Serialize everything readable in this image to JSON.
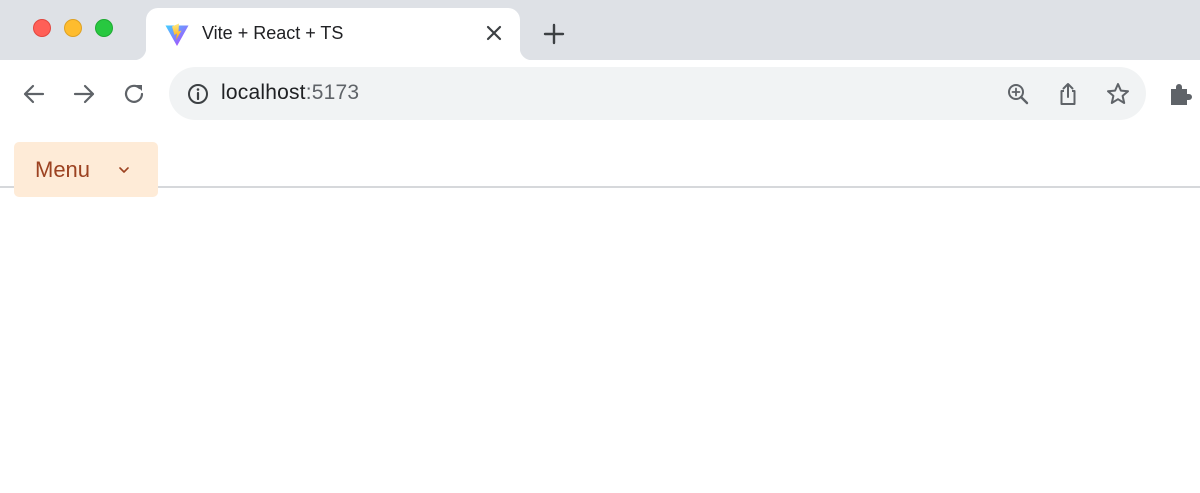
{
  "window": {
    "controls": [
      "close",
      "minimize",
      "zoom"
    ]
  },
  "tab": {
    "title": "Vite + React + TS",
    "favicon": "vite-logo-icon",
    "close_icon": "close-icon"
  },
  "new_tab_icon": "plus-icon",
  "toolbar": {
    "back_icon": "arrow-left-icon",
    "forward_icon": "arrow-right-icon",
    "reload_icon": "reload-icon",
    "extensions_icon": "puzzle-icon"
  },
  "address_bar": {
    "host": "localhost",
    "port": ":5173",
    "info_icon": "info-icon",
    "zoom_icon": "zoom-in-icon",
    "share_icon": "share-icon",
    "bookmark_icon": "star-icon"
  },
  "page": {
    "menu_button": {
      "label": "Menu",
      "icon": "chevron-down-icon",
      "background": "#feebd7",
      "text_color": "#9c4221"
    }
  },
  "colors": {
    "tabstrip": "#dee1e6",
    "omnibox": "#f1f3f4",
    "icon": "#5f6368"
  }
}
